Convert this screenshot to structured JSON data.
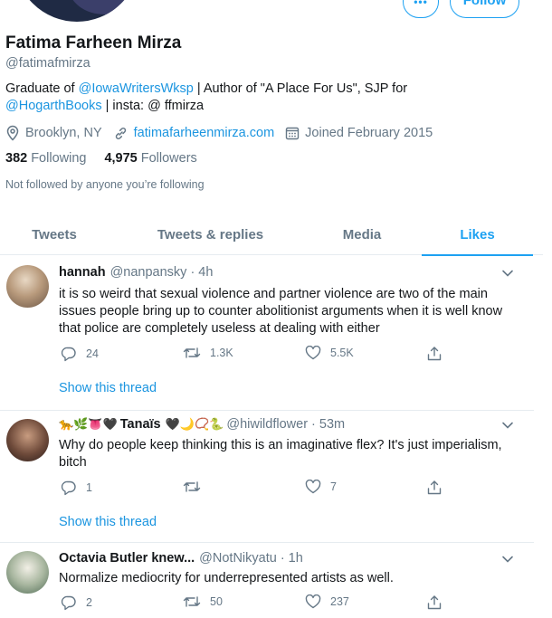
{
  "profile": {
    "more_label": "•••",
    "follow_label": "Follow",
    "name": "Fatima Farheen Mirza",
    "handle": "@fatimafmirza",
    "bio": {
      "pre": "Graduate of ",
      "link1": "@IowaWritersWksp",
      "mid": " | Author of \"A Place For Us\", SJP for",
      "link2": "@HogarthBooks",
      "post": " | insta: @ ffmirza"
    },
    "location": "Brooklyn, NY",
    "website": "fatimafarheenmirza.com",
    "joined": "Joined February 2015",
    "following_count": "382",
    "following_label": "Following",
    "followers_count": "4,975",
    "followers_label": "Followers",
    "not_followed": "Not followed by anyone you’re following"
  },
  "tabs": [
    {
      "label": "Tweets"
    },
    {
      "label": "Tweets & replies"
    },
    {
      "label": "Media"
    },
    {
      "label": "Likes"
    }
  ],
  "tweets": [
    {
      "name": "hannah",
      "meta": "@nanpansky · 4h",
      "text": "it is so weird that sexual violence and partner violence are two of the main issues people bring up to counter abolitionist arguments when it is well know that police are completely useless at dealing with either",
      "replies": "24",
      "retweets": "1.3K",
      "likes": "5.5K",
      "show_thread": "Show this thread"
    },
    {
      "name_prefix_emojis": "🐆🌿👅🖤",
      "name": "Tanaïs",
      "name_suffix_emojis": "🖤🌙📿🐍",
      "meta": "@hiwildflower · 53m",
      "text": "Why do people keep thinking this is an imaginative flex? It's just imperialism, bitch",
      "replies": "1",
      "retweets": "",
      "likes": "7",
      "show_thread": "Show this thread"
    },
    {
      "name": "Octavia Butler knew...",
      "meta": "@NotNikyatu · 1h",
      "text": "Normalize mediocrity for underrepresented artists as well.",
      "replies": "2",
      "retweets": "50",
      "likes": "237"
    }
  ],
  "colors": {
    "accent": "#1da1f2",
    "link": "#1b95e0",
    "secondary_text": "#657786",
    "border": "#e6ecf0"
  }
}
